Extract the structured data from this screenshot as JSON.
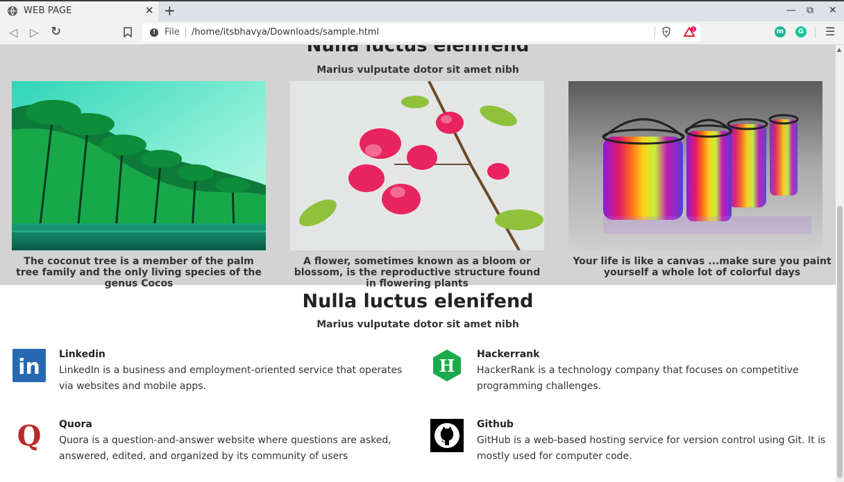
{
  "browser": {
    "tab_title": "WEB PAGE",
    "tab_close": "✕",
    "new_tab": "+",
    "minimize": "—",
    "restore": "⧉",
    "close": "✕",
    "back": "◁",
    "forward": "▷",
    "reload": "↻",
    "url_scheme": "File",
    "url_path": "/home/itsbhavya/Downloads/sample.html",
    "bat_badge": "2",
    "ext_1": "m",
    "ext_2": "G",
    "menu": "☰"
  },
  "gallery": {
    "heading": "Nulla luctus elenifend",
    "subheading": "Marius vulputate dotor sit amet nibh",
    "cards": [
      {
        "caption": "The coconut tree is a member of the palm tree family and the only living species of the genus Cocos"
      },
      {
        "caption": "A flower, sometimes known as a bloom or blossom, is the reproductive structure found in flowering plants"
      },
      {
        "caption": "Your life is like a canvas ...make sure you paint yourself a whole lot of colorful days"
      }
    ]
  },
  "sites": {
    "heading": "Nulla luctus elenifend",
    "subheading": "Marius vulputate dotor sit amet nibh",
    "items": [
      {
        "title": "Linkedin",
        "desc": "LinkedIn is a business and employment-oriented service that operates via websites and mobile apps.",
        "logo_text": "in",
        "color": "#2867b2"
      },
      {
        "title": "Hackerrank",
        "desc": "HackerRank is a technology company that focuses on competitive programming challenges.",
        "logo_text": "H",
        "color": "#1ba94c"
      },
      {
        "title": "Quora",
        "desc": "Quora is a question-and-answer website where questions are asked, answered, edited, and organized by its community of users",
        "logo_text": "Q",
        "color": "#b92b27"
      },
      {
        "title": "Github",
        "desc": "GitHub is a web-based hosting service for version control using Git. It is mostly used for computer code.",
        "logo_text": "",
        "color": "#000000"
      }
    ]
  }
}
